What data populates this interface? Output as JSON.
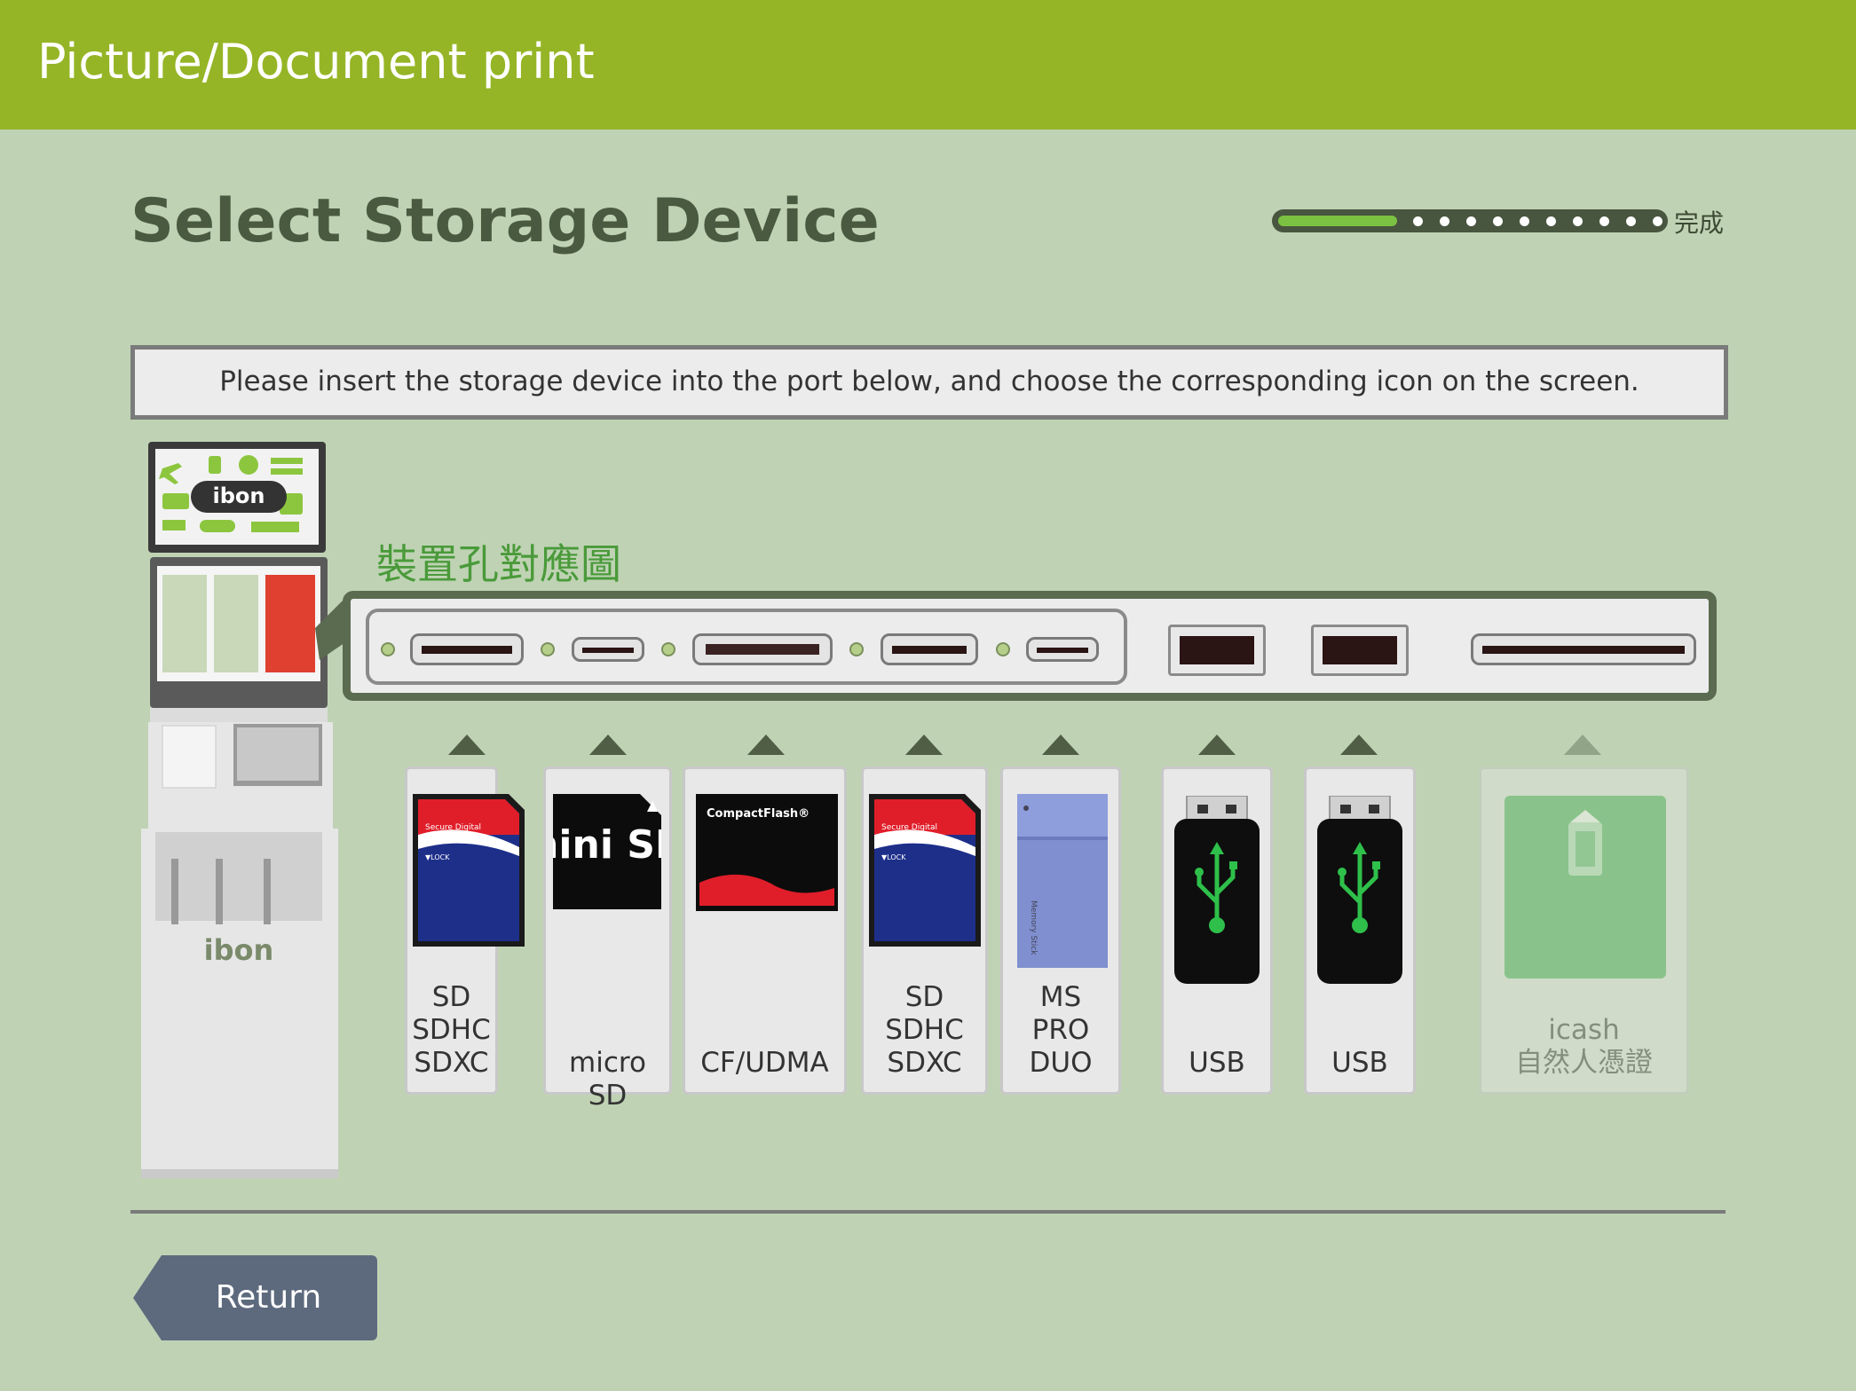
{
  "header": {
    "title": "Picture/Document print",
    "bar_color": "#95b526"
  },
  "page": {
    "title": "Select Storage Device"
  },
  "progress": {
    "steps_total": 11,
    "current_step": 1,
    "end_label": "完成",
    "fill_color": "#7cc242"
  },
  "instruction": "Please insert the storage device into the port below, and choose the corresponding icon on the screen.",
  "port_map": {
    "label": "裝置孔對應圖"
  },
  "kiosk": {
    "brand": "ibon",
    "screen_brand": "ibon"
  },
  "devices": [
    {
      "id": "sd-1",
      "lines": [
        "SD",
        "SDHC",
        "SDXC"
      ],
      "icon": "sd-card-icon",
      "enabled": true
    },
    {
      "id": "microsd",
      "lines": [
        "micro SD"
      ],
      "icon": "micro-sd-card-icon",
      "icon_text": "mini SD",
      "enabled": true
    },
    {
      "id": "cf",
      "lines": [
        "CF/UDMA"
      ],
      "icon": "compact-flash-icon",
      "icon_text": "CompactFlash®",
      "enabled": true
    },
    {
      "id": "sd-2",
      "lines": [
        "SD",
        "SDHC",
        "SDXC"
      ],
      "icon": "sd-card-icon",
      "enabled": true
    },
    {
      "id": "ms",
      "lines": [
        "MS",
        "PRO",
        "DUO"
      ],
      "icon": "memory-stick-icon",
      "icon_text": "Memory Stick",
      "enabled": true
    },
    {
      "id": "usb-1",
      "lines": [
        "USB"
      ],
      "icon": "usb-drive-icon",
      "enabled": true
    },
    {
      "id": "usb-2",
      "lines": [
        "USB"
      ],
      "icon": "usb-drive-icon",
      "enabled": true
    },
    {
      "id": "icash",
      "lines": [
        "icash",
        "自然人憑證"
      ],
      "icon": "smart-card-icon",
      "enabled": false
    }
  ],
  "sd_card_text": {
    "brand": "Secure Digital",
    "lock": "▼LOCK"
  },
  "footer": {
    "return_label": "Return"
  }
}
